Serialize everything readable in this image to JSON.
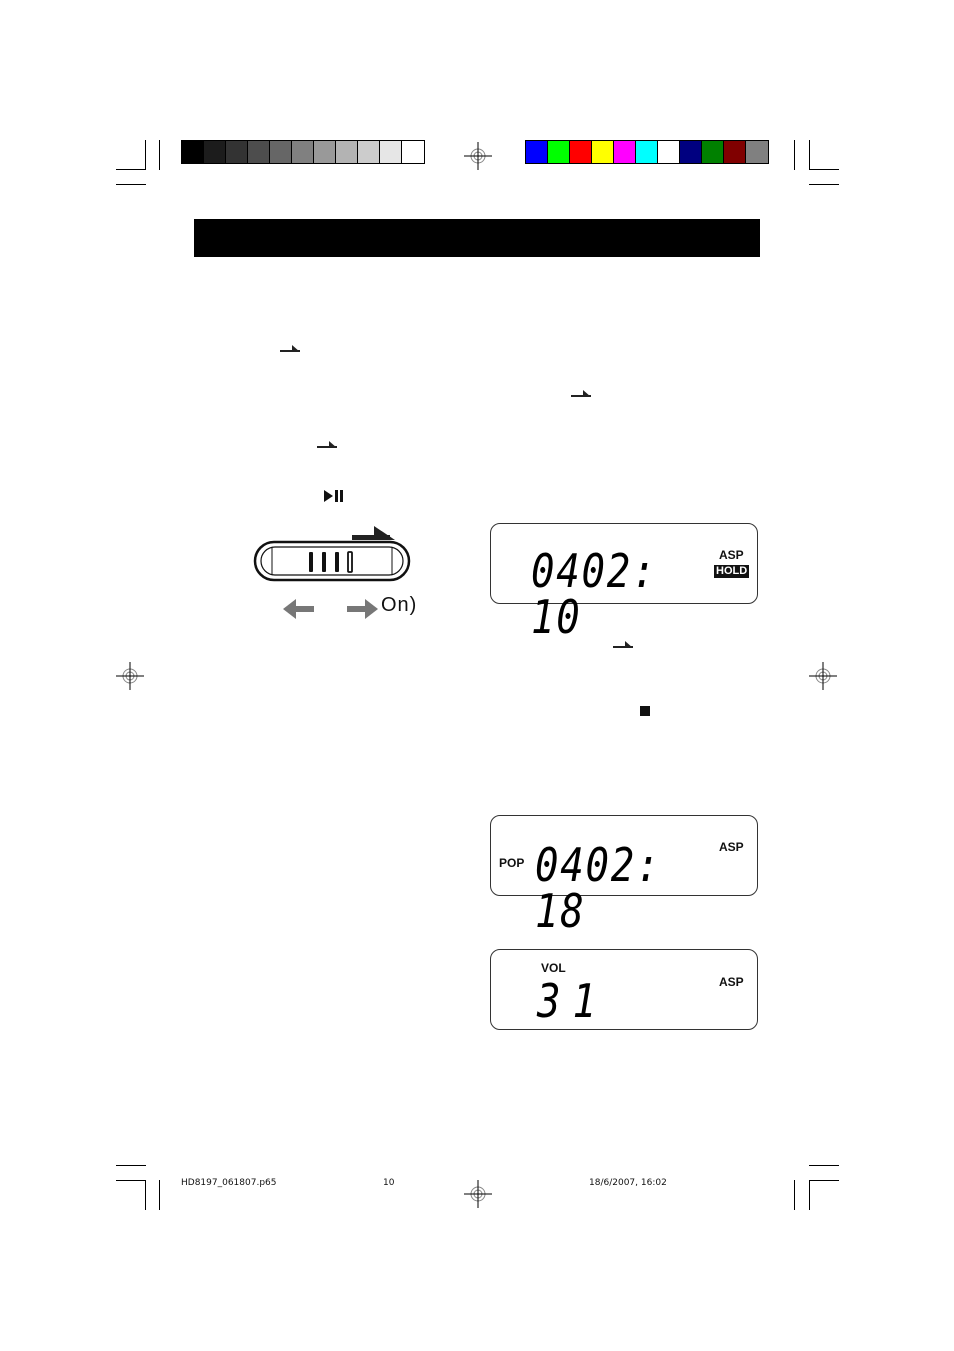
{
  "color_bars": {
    "grayscale": [
      "#000000",
      "#1c1c1c",
      "#333333",
      "#4d4d4d",
      "#666666",
      "#808080",
      "#999999",
      "#b3b3b3",
      "#cccccc",
      "#e6e6e6",
      "#ffffff"
    ],
    "colors": [
      "#0000ff",
      "#00ff00",
      "#ff0000",
      "#ffff00",
      "#ff00ff",
      "#00ffff",
      "#ffffff",
      "#000080",
      "#008000",
      "#800000",
      "#808080"
    ]
  },
  "header": {
    "title": ""
  },
  "icons": {
    "slide_arrow": "slide-right-arrow",
    "play_pause": "▶II",
    "stop": "■"
  },
  "hold_switch": {
    "on_label": "On)",
    "left_arrow": "←",
    "right_arrow": "→"
  },
  "lcd_displays": [
    {
      "digits": "0402",
      "time": "10",
      "separator": ":",
      "indicators": [
        "ASP",
        "HOLD"
      ]
    },
    {
      "left_label": "POP",
      "digits": "0402",
      "time": "18",
      "separator": ":",
      "indicators": [
        "ASP"
      ]
    },
    {
      "top_label": "VOL",
      "value": "31",
      "indicators": [
        "ASP"
      ]
    }
  ],
  "footer": {
    "filename": "HD8197_061807.p65",
    "page_number": "10",
    "datetime": "18/6/2007, 16:02"
  }
}
